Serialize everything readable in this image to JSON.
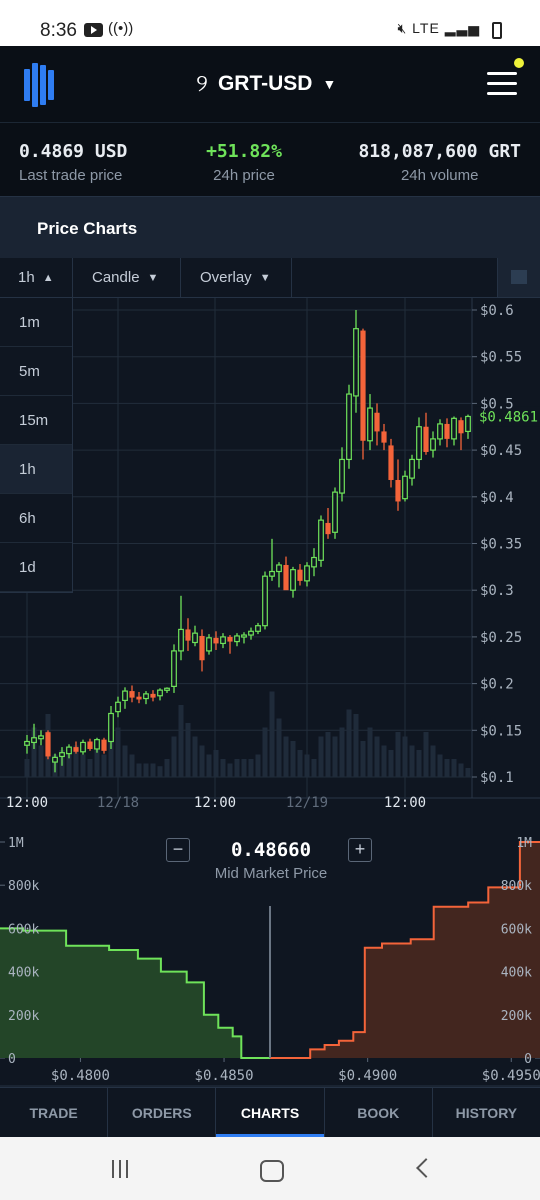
{
  "status_bar": {
    "time": "8:36",
    "icons": [
      "youtube-icon",
      "broadcast-icon",
      "mute-icon",
      "volte-icon",
      "signal-icon",
      "battery-icon"
    ],
    "network": "LTE"
  },
  "header": {
    "pair": "GRT-USD",
    "icons": [
      "logo-icon",
      "token-glyph-icon",
      "chevron-down-icon",
      "hamburger-menu-icon"
    ]
  },
  "stats": {
    "last_trade": {
      "value": "0.4869 USD",
      "label": "Last trade price"
    },
    "change": {
      "value": "+51.82%",
      "label": "24h price"
    },
    "volume": {
      "value": "818,087,600 GRT",
      "label": "24h volume"
    }
  },
  "section_title": "Price Charts",
  "controls": {
    "interval": "1h",
    "chart_type": "Candle",
    "overlay": "Overlay"
  },
  "interval_options": [
    "1m",
    "5m",
    "15m",
    "1h",
    "6h",
    "1d"
  ],
  "selected_interval": "1h",
  "mid_market": {
    "price": "0.48660",
    "label": "Mid Market Price",
    "minus": "−",
    "plus": "+"
  },
  "tabs": [
    "TRADE",
    "ORDERS",
    "CHARTS",
    "BOOK",
    "HISTORY"
  ],
  "active_tab": "CHARTS",
  "colors": {
    "up": "#6fe35a",
    "down": "#f4643a",
    "accent": "#2f7df2",
    "bg": "#0f1621"
  },
  "chart_data": [
    {
      "type": "candlestick",
      "x_ticks": [
        "12:00",
        "12/18",
        "12:00",
        "12/19",
        "12:00"
      ],
      "y_ticks": [
        "$0.6",
        "$0.55",
        "$0.5",
        "$0.45",
        "$0.4",
        "$0.35",
        "$0.3",
        "$0.25",
        "$0.2",
        "$0.15",
        "$0.1"
      ],
      "ylim": [
        0.1,
        0.6
      ],
      "last_price_label": "$0.4861",
      "last_price": 0.4861,
      "candles": [
        {
          "o": 0.134,
          "h": 0.145,
          "l": 0.125,
          "c": 0.138
        },
        {
          "o": 0.137,
          "h": 0.157,
          "l": 0.13,
          "c": 0.142
        },
        {
          "o": 0.141,
          "h": 0.15,
          "l": 0.134,
          "c": 0.144
        },
        {
          "o": 0.148,
          "h": 0.15,
          "l": 0.119,
          "c": 0.122
        },
        {
          "o": 0.116,
          "h": 0.125,
          "l": 0.105,
          "c": 0.121
        },
        {
          "o": 0.122,
          "h": 0.132,
          "l": 0.112,
          "c": 0.126
        },
        {
          "o": 0.125,
          "h": 0.135,
          "l": 0.12,
          "c": 0.132
        },
        {
          "o": 0.132,
          "h": 0.138,
          "l": 0.125,
          "c": 0.127
        },
        {
          "o": 0.127,
          "h": 0.14,
          "l": 0.124,
          "c": 0.137
        },
        {
          "o": 0.138,
          "h": 0.141,
          "l": 0.128,
          "c": 0.13
        },
        {
          "o": 0.13,
          "h": 0.142,
          "l": 0.126,
          "c": 0.14
        },
        {
          "o": 0.14,
          "h": 0.142,
          "l": 0.125,
          "c": 0.128
        },
        {
          "o": 0.138,
          "h": 0.176,
          "l": 0.13,
          "c": 0.168
        },
        {
          "o": 0.17,
          "h": 0.186,
          "l": 0.164,
          "c": 0.18
        },
        {
          "o": 0.182,
          "h": 0.196,
          "l": 0.173,
          "c": 0.192
        },
        {
          "o": 0.192,
          "h": 0.198,
          "l": 0.18,
          "c": 0.185
        },
        {
          "o": 0.186,
          "h": 0.191,
          "l": 0.179,
          "c": 0.183
        },
        {
          "o": 0.184,
          "h": 0.192,
          "l": 0.178,
          "c": 0.189
        },
        {
          "o": 0.189,
          "h": 0.193,
          "l": 0.181,
          "c": 0.185
        },
        {
          "o": 0.187,
          "h": 0.195,
          "l": 0.182,
          "c": 0.193
        },
        {
          "o": 0.193,
          "h": 0.196,
          "l": 0.19,
          "c": 0.195
        },
        {
          "o": 0.197,
          "h": 0.242,
          "l": 0.19,
          "c": 0.235
        },
        {
          "o": 0.235,
          "h": 0.294,
          "l": 0.225,
          "c": 0.258
        },
        {
          "o": 0.258,
          "h": 0.27,
          "l": 0.235,
          "c": 0.246
        },
        {
          "o": 0.244,
          "h": 0.262,
          "l": 0.24,
          "c": 0.254
        },
        {
          "o": 0.251,
          "h": 0.258,
          "l": 0.213,
          "c": 0.225
        },
        {
          "o": 0.235,
          "h": 0.253,
          "l": 0.231,
          "c": 0.249
        },
        {
          "o": 0.249,
          "h": 0.256,
          "l": 0.236,
          "c": 0.243
        },
        {
          "o": 0.243,
          "h": 0.254,
          "l": 0.238,
          "c": 0.25
        },
        {
          "o": 0.25,
          "h": 0.252,
          "l": 0.232,
          "c": 0.245
        },
        {
          "o": 0.245,
          "h": 0.254,
          "l": 0.24,
          "c": 0.251
        },
        {
          "o": 0.25,
          "h": 0.255,
          "l": 0.243,
          "c": 0.252
        },
        {
          "o": 0.252,
          "h": 0.26,
          "l": 0.247,
          "c": 0.256
        },
        {
          "o": 0.256,
          "h": 0.265,
          "l": 0.253,
          "c": 0.262
        },
        {
          "o": 0.262,
          "h": 0.32,
          "l": 0.258,
          "c": 0.315
        },
        {
          "o": 0.315,
          "h": 0.355,
          "l": 0.31,
          "c": 0.32
        },
        {
          "o": 0.32,
          "h": 0.33,
          "l": 0.303,
          "c": 0.327
        },
        {
          "o": 0.327,
          "h": 0.336,
          "l": 0.315,
          "c": 0.3
        },
        {
          "o": 0.3,
          "h": 0.325,
          "l": 0.292,
          "c": 0.322
        },
        {
          "o": 0.322,
          "h": 0.328,
          "l": 0.305,
          "c": 0.31
        },
        {
          "o": 0.31,
          "h": 0.33,
          "l": 0.304,
          "c": 0.326
        },
        {
          "o": 0.325,
          "h": 0.345,
          "l": 0.315,
          "c": 0.335
        },
        {
          "o": 0.332,
          "h": 0.38,
          "l": 0.325,
          "c": 0.375
        },
        {
          "o": 0.372,
          "h": 0.388,
          "l": 0.355,
          "c": 0.36
        },
        {
          "o": 0.362,
          "h": 0.41,
          "l": 0.355,
          "c": 0.405
        },
        {
          "o": 0.404,
          "h": 0.453,
          "l": 0.395,
          "c": 0.44
        },
        {
          "o": 0.44,
          "h": 0.52,
          "l": 0.43,
          "c": 0.51
        },
        {
          "o": 0.508,
          "h": 0.6,
          "l": 0.49,
          "c": 0.58
        },
        {
          "o": 0.578,
          "h": 0.58,
          "l": 0.44,
          "c": 0.46
        },
        {
          "o": 0.46,
          "h": 0.51,
          "l": 0.45,
          "c": 0.495
        },
        {
          "o": 0.49,
          "h": 0.5,
          "l": 0.455,
          "c": 0.47
        },
        {
          "o": 0.47,
          "h": 0.478,
          "l": 0.45,
          "c": 0.458
        },
        {
          "o": 0.455,
          "h": 0.462,
          "l": 0.41,
          "c": 0.418
        },
        {
          "o": 0.418,
          "h": 0.44,
          "l": 0.385,
          "c": 0.395
        },
        {
          "o": 0.398,
          "h": 0.428,
          "l": 0.395,
          "c": 0.422
        },
        {
          "o": 0.42,
          "h": 0.445,
          "l": 0.412,
          "c": 0.44
        },
        {
          "o": 0.44,
          "h": 0.485,
          "l": 0.43,
          "c": 0.475
        },
        {
          "o": 0.475,
          "h": 0.49,
          "l": 0.445,
          "c": 0.448
        },
        {
          "o": 0.45,
          "h": 0.47,
          "l": 0.442,
          "c": 0.462
        },
        {
          "o": 0.462,
          "h": 0.483,
          "l": 0.455,
          "c": 0.478
        },
        {
          "o": 0.478,
          "h": 0.484,
          "l": 0.453,
          "c": 0.462
        },
        {
          "o": 0.462,
          "h": 0.486,
          "l": 0.455,
          "c": 0.484
        },
        {
          "o": 0.482,
          "h": 0.485,
          "l": 0.45,
          "c": 0.468
        },
        {
          "o": 0.47,
          "h": 0.488,
          "l": 0.462,
          "c": 0.486
        }
      ],
      "volume_relative": [
        0.2,
        0.55,
        0.35,
        0.7,
        0.25,
        0.3,
        0.25,
        0.35,
        0.25,
        0.2,
        0.3,
        0.25,
        0.5,
        0.55,
        0.35,
        0.25,
        0.15,
        0.15,
        0.15,
        0.12,
        0.2,
        0.45,
        0.8,
        0.6,
        0.45,
        0.35,
        0.25,
        0.3,
        0.2,
        0.15,
        0.2,
        0.2,
        0.2,
        0.25,
        0.55,
        0.95,
        0.65,
        0.45,
        0.4,
        0.3,
        0.25,
        0.2,
        0.45,
        0.5,
        0.45,
        0.55,
        0.75,
        0.7,
        0.4,
        0.55,
        0.45,
        0.35,
        0.3,
        0.5,
        0.45,
        0.35,
        0.3,
        0.5,
        0.35,
        0.25,
        0.2,
        0.2,
        0.15,
        0.1
      ]
    },
    {
      "type": "area",
      "name": "depth",
      "x_ticks": [
        "$0.4800",
        "$0.4850",
        "$0.4900",
        "$0.4950"
      ],
      "y_ticks": [
        "0",
        "200k",
        "400k",
        "600k",
        "800k",
        "1M"
      ],
      "xlim": [
        0.4772,
        0.496
      ],
      "ylim": [
        0,
        1000000
      ],
      "mid": 0.4866,
      "bids": [
        [
          0.4772,
          600000
        ],
        [
          0.478,
          600000
        ],
        [
          0.478,
          590000
        ],
        [
          0.4795,
          590000
        ],
        [
          0.4795,
          520000
        ],
        [
          0.481,
          520000
        ],
        [
          0.481,
          500000
        ],
        [
          0.482,
          500000
        ],
        [
          0.482,
          460000
        ],
        [
          0.4828,
          460000
        ],
        [
          0.4828,
          400000
        ],
        [
          0.4837,
          400000
        ],
        [
          0.4837,
          350000
        ],
        [
          0.4843,
          350000
        ],
        [
          0.4843,
          200000
        ],
        [
          0.4848,
          200000
        ],
        [
          0.4848,
          140000
        ],
        [
          0.4853,
          140000
        ],
        [
          0.4853,
          100000
        ],
        [
          0.4856,
          100000
        ],
        [
          0.4856,
          0
        ],
        [
          0.4866,
          0
        ]
      ],
      "asks": [
        [
          0.4866,
          0
        ],
        [
          0.488,
          0
        ],
        [
          0.488,
          40000
        ],
        [
          0.4885,
          40000
        ],
        [
          0.4885,
          60000
        ],
        [
          0.489,
          60000
        ],
        [
          0.489,
          80000
        ],
        [
          0.4895,
          80000
        ],
        [
          0.4895,
          120000
        ],
        [
          0.4899,
          120000
        ],
        [
          0.4899,
          510000
        ],
        [
          0.4905,
          510000
        ],
        [
          0.4905,
          530000
        ],
        [
          0.4915,
          530000
        ],
        [
          0.4915,
          550000
        ],
        [
          0.4923,
          550000
        ],
        [
          0.4923,
          700000
        ],
        [
          0.4935,
          700000
        ],
        [
          0.4935,
          720000
        ],
        [
          0.4942,
          720000
        ],
        [
          0.4942,
          790000
        ],
        [
          0.4953,
          790000
        ],
        [
          0.4953,
          1000000
        ],
        [
          0.496,
          1000000
        ]
      ]
    }
  ]
}
